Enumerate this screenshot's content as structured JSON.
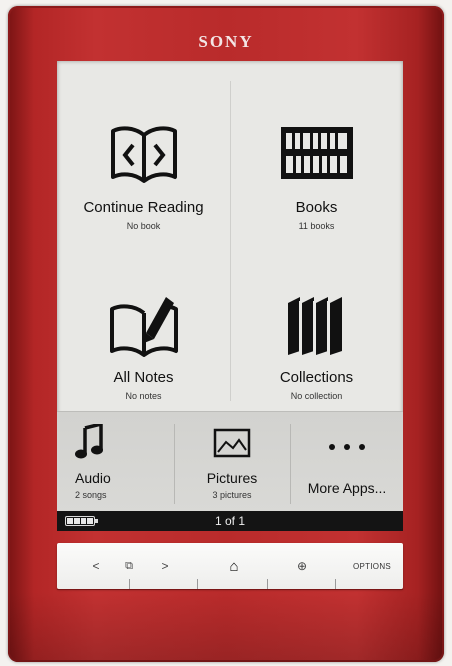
{
  "device": {
    "brand": "SONY",
    "accent_color": "#c23131"
  },
  "home": {
    "tiles": [
      {
        "label": "Continue Reading",
        "sub": "No book",
        "icon": "open-book-arrows-icon"
      },
      {
        "label": "Books",
        "sub": "11 books",
        "icon": "bookshelf-icon"
      },
      {
        "label": "All Notes",
        "sub": "No notes",
        "icon": "book-pen-icon"
      },
      {
        "label": "Collections",
        "sub": "No collection",
        "icon": "book-stack-icon"
      }
    ],
    "apps": [
      {
        "label": "Audio",
        "sub": "2 songs",
        "icon": "music-note-icon"
      },
      {
        "label": "Pictures",
        "sub": "3 pictures",
        "icon": "picture-icon"
      },
      {
        "label": "More Apps...",
        "icon": "ellipsis-icon"
      }
    ]
  },
  "status": {
    "page_indicator": "1 of 1",
    "battery_level": 1.0
  },
  "buttons": {
    "back": "<",
    "page": "⧉",
    "forward": ">",
    "home": "⌂",
    "zoom": "⊕",
    "options": "OPTIONS"
  }
}
